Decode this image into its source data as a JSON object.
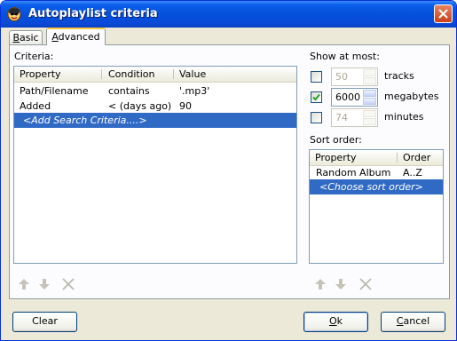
{
  "window": {
    "title": "Autoplaylist criteria"
  },
  "tabs": [
    {
      "label": "Basic",
      "mnemonic": "B",
      "rest": "asic",
      "selected": false
    },
    {
      "label": "Advanced",
      "mnemonic": "A",
      "rest": "dvanced",
      "selected": true
    }
  ],
  "criteria": {
    "label": "Criteria:",
    "columns": [
      "Property",
      "Condition",
      "Value"
    ],
    "rows": [
      {
        "property": "Path/Filename",
        "condition": "contains",
        "value": "'.mp3'"
      },
      {
        "property": "Added",
        "condition": "< (days ago)",
        "value": "90"
      }
    ],
    "add_row": "<Add Search Criteria....>"
  },
  "show_at_most": {
    "label": "Show at most:",
    "items": [
      {
        "value": "50",
        "unit": "tracks",
        "checked": false,
        "enabled": false
      },
      {
        "value": "6000",
        "unit": "megabytes",
        "checked": true,
        "enabled": true
      },
      {
        "value": "74",
        "unit": "minutes",
        "checked": false,
        "enabled": false
      }
    ]
  },
  "sort_order": {
    "label": "Sort order:",
    "columns": [
      "Property",
      "Order"
    ],
    "rows": [
      {
        "property": "Random Album",
        "order": "A..Z"
      }
    ],
    "add_row": "<Choose sort order>"
  },
  "buttons": {
    "clear": "Clear",
    "ok_mnemonic": "O",
    "ok_rest": "k",
    "cancel_mnemonic": "C",
    "cancel_rest": "ancel"
  },
  "colors": {
    "selection": "#316ac5",
    "titlebar": "#0550dc",
    "dialog_bg": "#ece9d8"
  },
  "icons": [
    "app-icon",
    "close-icon",
    "move-up-arrow-icon",
    "move-down-arrow-icon",
    "delete-x-icon",
    "checkmark-icon"
  ]
}
